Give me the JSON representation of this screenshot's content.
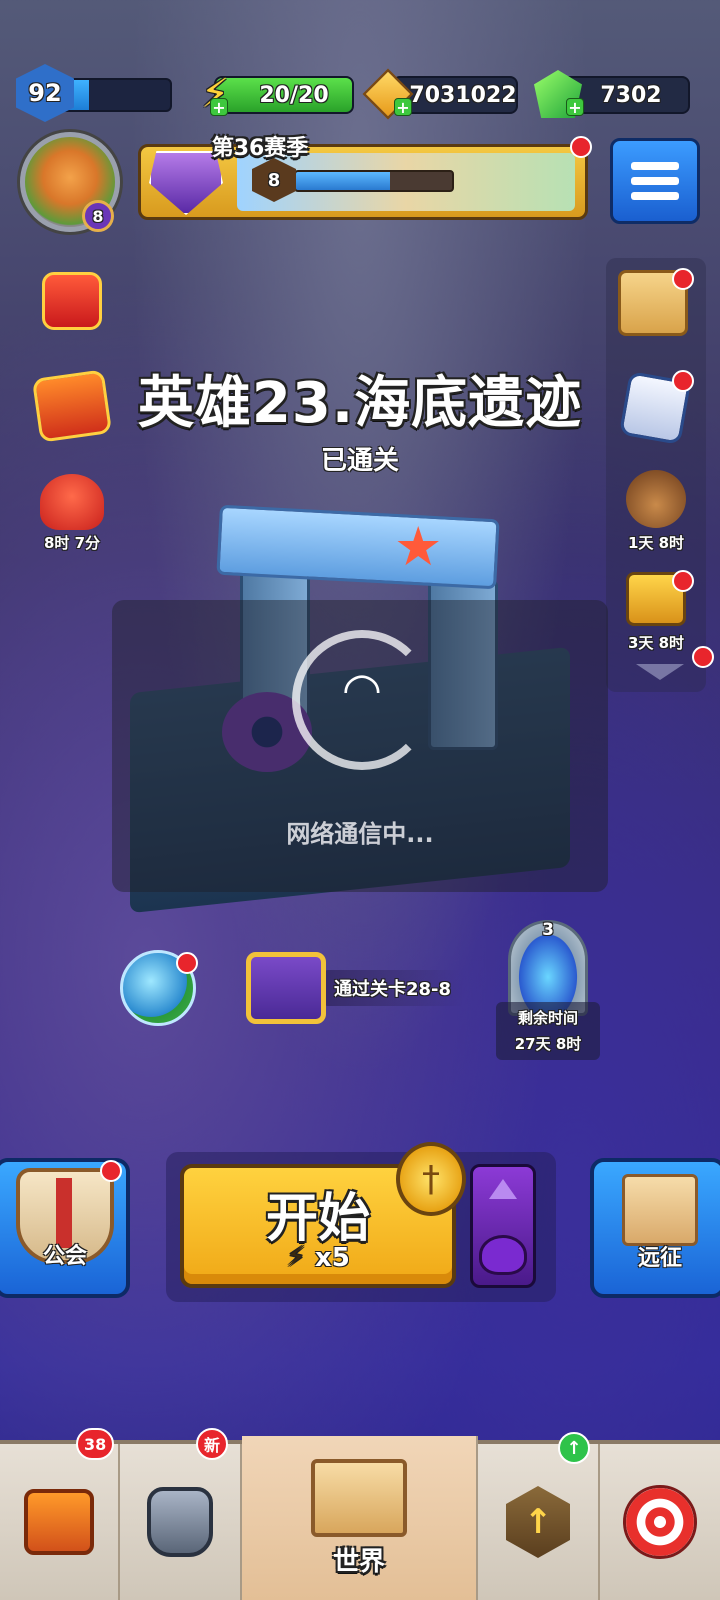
{
  "top_bar": {
    "player_level": "92",
    "xp_progress": 0.25,
    "energy": "20/20",
    "gold": "7031022",
    "gems": "7302"
  },
  "avatar": {
    "hero_level": "8"
  },
  "season": {
    "title": "第36赛季",
    "level": "8",
    "progress": 0.6
  },
  "left_icons": {
    "octopus_timer": "8时 7分"
  },
  "right_icons": {
    "wizard_timer": "1天 8时",
    "chest_timer": "3天 8时"
  },
  "stage": {
    "title": "英雄23.海底遗迹",
    "status": "已通关",
    "loading_text": "网络通信中..."
  },
  "rewards": {
    "chest_condition": "通过关卡28-8",
    "portal_count": "3",
    "portal_label": "剩余时间",
    "portal_time": "27天 8时"
  },
  "actions": {
    "guild_label": "公会",
    "start_label": "开始",
    "start_cost": "x5",
    "expedition_label": "远征"
  },
  "bottom_nav": {
    "chest_badge": "38",
    "armor_badge": "新",
    "world_label": "世界"
  },
  "colors": {
    "accent_blue": "#1a64d6",
    "start_yellow": "#ffd23f",
    "alert_red": "#e8252c"
  }
}
